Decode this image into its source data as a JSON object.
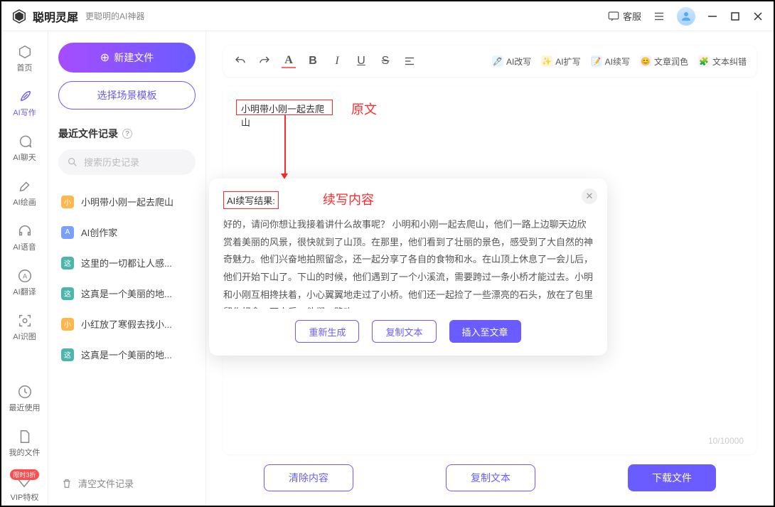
{
  "app": {
    "title": "聪明灵犀",
    "subtitle": "更聪明的AI神器"
  },
  "titlebar": {
    "feedback": "客服"
  },
  "nav": {
    "items": [
      {
        "label": "首页"
      },
      {
        "label": "AI写作"
      },
      {
        "label": "AI聊天"
      },
      {
        "label": "AI绘画"
      },
      {
        "label": "AI语音"
      },
      {
        "label": "AI翻译"
      },
      {
        "label": "AI识图"
      }
    ],
    "bottom": [
      {
        "label": "最近使用"
      },
      {
        "label": "我的文件"
      },
      {
        "label": "VIP特权",
        "badge": "限时3折"
      }
    ]
  },
  "sidebar": {
    "new_label": "新建文件",
    "template_label": "选择场景模板",
    "recent_title": "最近文件记录",
    "search_placeholder": "搜索历史记录",
    "files": [
      {
        "tag": "小",
        "cls": "t1",
        "name": "小明带小刚一起去爬山"
      },
      {
        "tag": "A",
        "cls": "t2",
        "name": "AI创作家"
      },
      {
        "tag": "这",
        "cls": "t3",
        "name": "这里的一切都让人感..."
      },
      {
        "tag": "这",
        "cls": "t3",
        "name": "这真是一个美丽的地..."
      },
      {
        "tag": "小",
        "cls": "t1",
        "name": "小红放了寒假去找小..."
      },
      {
        "tag": "这",
        "cls": "t3",
        "name": "这真是一个美丽的地..."
      }
    ],
    "clear_label": "清空文件记录"
  },
  "toolbar": {
    "ai": [
      {
        "label": "AI改写",
        "emoji": "🖊",
        "bg": "#4fc3f7"
      },
      {
        "label": "AI扩写",
        "emoji": "✨",
        "bg": "#ffb300"
      },
      {
        "label": "AI续写",
        "emoji": "📝",
        "bg": "#7b9fff"
      },
      {
        "label": "文章润色",
        "emoji": "😊",
        "bg": "#b388ff"
      },
      {
        "label": "文本纠错",
        "emoji": "🧩",
        "bg": "#ff8a80"
      }
    ]
  },
  "content": {
    "source_text": "小明带小刚一起去爬山",
    "anno_source": "原文",
    "anno_result": "续写内容",
    "counter": "10/10000"
  },
  "popup": {
    "title": "AI续写结果:",
    "body": "好的，请问你想让我接着讲什么故事呢？ 小明和小刚一起去爬山，他们一路上边聊天边欣赏着美丽的风景，很快就到了山顶。在那里，他们看到了壮丽的景色，感受到了大自然的神奇魅力。他们兴奋地拍照留念，还一起分享了各自的食物和水。在山顶上休息了一会儿后，他们开始下山了。下山的时候，他们遇到了一个小溪流，需要跨过一条小桥才能过去。小明和小刚互相搀扶着，小心翼翼地走过了小桥。他们还一起捡了一些漂亮的石头，放在了包里留作纪念。下山后，他们一路欢",
    "regen": "重新生成",
    "copy": "复制文本",
    "insert": "插入至文章"
  },
  "bottom": {
    "clear": "清除内容",
    "copy": "复制文本",
    "download": "下载文件"
  }
}
